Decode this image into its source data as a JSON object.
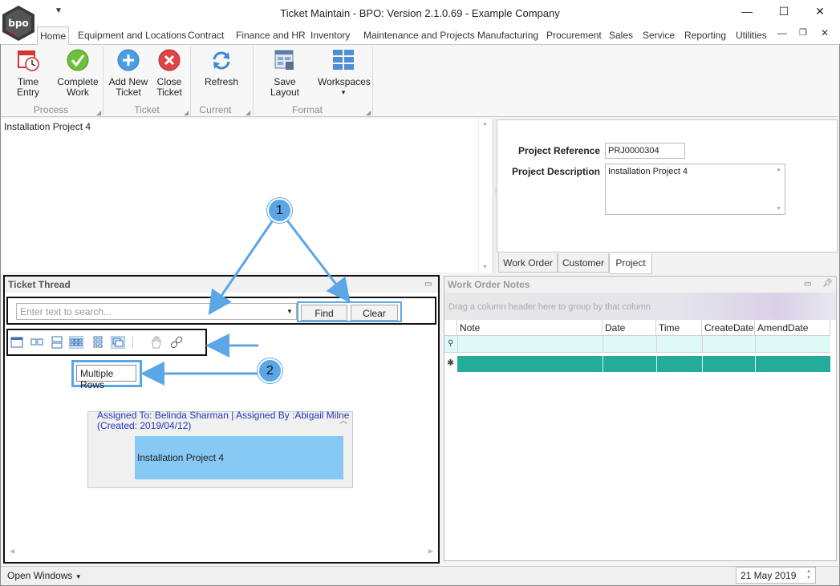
{
  "window": {
    "title": "Ticket Maintain - BPO: Version 2.1.0.69 - Example Company",
    "logo_text": "bpo",
    "controls": {
      "minimize": "—",
      "maximize": "☐",
      "close": "✕"
    }
  },
  "ribbon": {
    "tabs": [
      "Home",
      "Equipment and Locations",
      "Contract",
      "Finance and HR",
      "Inventory",
      "Maintenance and Projects",
      "Manufacturing",
      "Procurement",
      "Sales",
      "Service",
      "Reporting",
      "Utilities"
    ],
    "groups": {
      "process": {
        "label": "Process",
        "buttons": [
          {
            "line1": "Time Entry",
            "line2": "",
            "icon": "calendar-clock-icon"
          },
          {
            "line1": "Complete",
            "line2": "Work",
            "icon": "checkmark-icon"
          }
        ]
      },
      "ticket": {
        "label": "Ticket",
        "buttons": [
          {
            "line1": "Add New",
            "line2": "Ticket",
            "icon": "add-icon"
          },
          {
            "line1": "Close",
            "line2": "Ticket",
            "icon": "close-icon"
          }
        ]
      },
      "current": {
        "label": "Current",
        "buttons": [
          {
            "line1": "Refresh",
            "line2": "",
            "icon": "refresh-icon"
          }
        ]
      },
      "format": {
        "label": "Format",
        "buttons": [
          {
            "line1": "Save Layout",
            "line2": "",
            "icon": "save-layout-icon"
          },
          {
            "line1": "Workspaces",
            "line2": "▾",
            "icon": "workspaces-icon"
          }
        ]
      }
    }
  },
  "upper_left": {
    "text": "Installation Project 4"
  },
  "project": {
    "ref_label": "Project Reference",
    "ref_value": "PRJ0000304",
    "desc_label": "Project Description",
    "desc_value": "Installation Project 4",
    "tabs": [
      "Work Order",
      "Customer",
      "Project"
    ],
    "active_tab": "Project"
  },
  "ticket_thread": {
    "title": "Ticket Thread",
    "search_placeholder": "Enter text to search...",
    "find_label": "Find",
    "clear_label": "Clear",
    "layout_icons": [
      "single-row-icon",
      "two-columns-icon",
      "two-rows-icon",
      "multiple-rows-icon",
      "grid-icon",
      "carousel-icon",
      "pan-hand-icon",
      "link-icon"
    ],
    "tooltip": "Multiple Rows",
    "card": {
      "header_line1": "Assigned To: Belinda Sharman  | Assigned By :Abigail Milne",
      "header_line2": "(Created: 2019/04/12)",
      "body": "Installation Project 4"
    }
  },
  "work_order_notes": {
    "title": "Work Order Notes",
    "group_hint": "Drag a column header here to group by that column",
    "columns": [
      "Note",
      "Date",
      "Time",
      "CreateDate",
      "AmendDate"
    ]
  },
  "statusbar": {
    "open_windows": "Open Windows",
    "date": "21 May 2019"
  },
  "callouts": [
    "1",
    "2"
  ],
  "colors": {
    "accent": "#5aa6e6",
    "new_row": "#24ac9a",
    "card_body": "#87c9f5"
  }
}
